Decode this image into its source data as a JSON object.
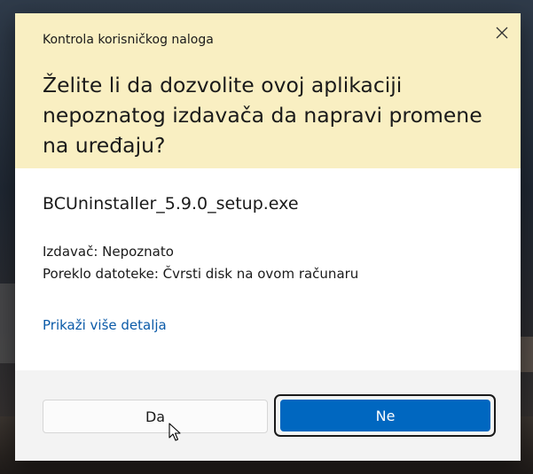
{
  "dialog": {
    "caption": "Kontrola korisničkog naloga",
    "question": "Želite li da dozvolite ovoj aplikaciji nepoznatog izdavača da napravi promene na uređaju?",
    "app_name": "BCUninstaller_5.9.0_setup.exe",
    "publisher": "Izdavač: Nepoznato",
    "origin": "Poreklo datoteke: Čvrsti disk na ovom računaru",
    "details_link": "Prikaži više detalja",
    "yes_label": "Da",
    "no_label": "Ne"
  },
  "icons": {
    "close": "close-icon",
    "cursor": "mouse-pointer-icon"
  },
  "colors": {
    "header_bg": "#f9efc2",
    "primary_button": "#0067c0",
    "link": "#0a5aa8"
  }
}
